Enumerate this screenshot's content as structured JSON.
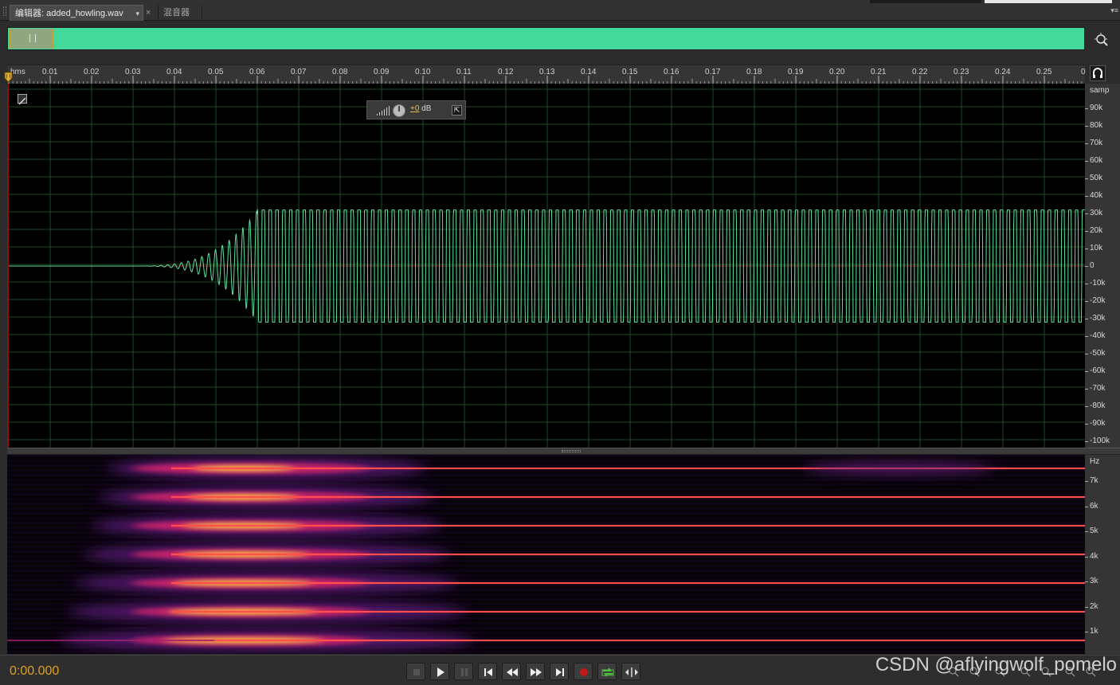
{
  "tabs": {
    "editor_label": "编辑器: added_howling.wav",
    "editor_dropdown": "▾",
    "close": "×",
    "mixer_label": "混音器",
    "panel_menu": "▾≡"
  },
  "ruler": {
    "unit": "hms",
    "labels": [
      "0.01",
      "0.02",
      "0.03",
      "0.04",
      "0.05",
      "0.06",
      "0.07",
      "0.08",
      "0.09",
      "0.10",
      "0.11",
      "0.12",
      "0.13",
      "0.14",
      "0.15",
      "0.16",
      "0.17",
      "0.18",
      "0.19",
      "0.20",
      "0.21",
      "0.22",
      "0.23",
      "0.24",
      "0.25",
      "0"
    ]
  },
  "hud": {
    "gain_value": "+0",
    "gain_unit": " dB"
  },
  "amplitude_axis": {
    "unit": "samp",
    "labels": [
      "90k",
      "80k",
      "70k",
      "60k",
      "50k",
      "40k",
      "30k",
      "20k",
      "10k",
      "0",
      "-10k",
      "-20k",
      "-30k",
      "-40k",
      "-50k",
      "-60k",
      "-70k",
      "-80k",
      "-90k",
      "-100k"
    ]
  },
  "frequency_axis": {
    "unit": "Hz",
    "labels": [
      "7k",
      "6k",
      "5k",
      "4k",
      "3k",
      "2k",
      "1k"
    ]
  },
  "waveform": {
    "color": "#5fe0a0",
    "grid_color": "#1f4a22",
    "onset_time_s": 0.03,
    "full_amplitude_time_s": 0.06,
    "peak_amplitude": 32000
  },
  "spectrogram": {
    "harmonic_frequencies_hz": [
      600,
      1700,
      2800,
      3900,
      5000,
      6100,
      7200
    ]
  },
  "transport": {
    "timecode": "0:00.000",
    "watermark": "CSDN @aflyingwolf_pomelo"
  },
  "colors": {
    "overview_fill": "#43d99b",
    "timecode": "#e0a020",
    "waveform_bg": "#000000"
  }
}
